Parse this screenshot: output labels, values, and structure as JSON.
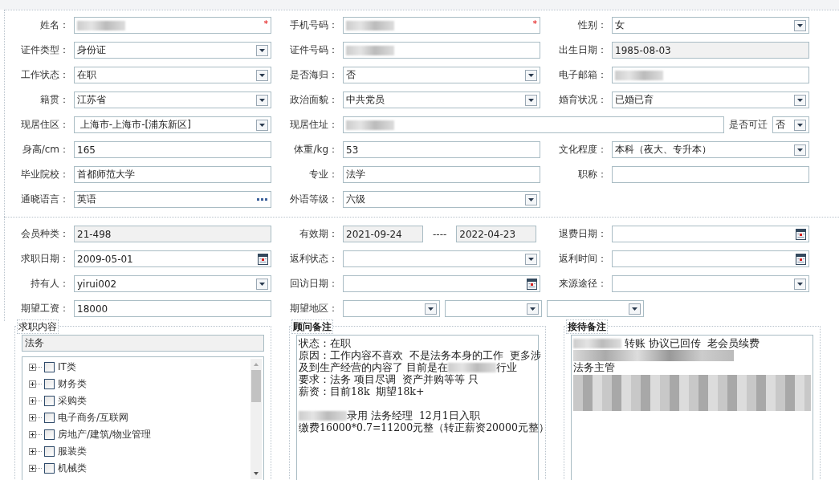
{
  "personal_info": {
    "rows": [
      [
        {
          "label": "姓名：",
          "kind": "text",
          "redacted": true,
          "required_mark": "*"
        },
        {
          "label": "手机号码：",
          "kind": "text",
          "redacted": true,
          "required_mark": "*"
        },
        {
          "label": "性别：",
          "kind": "select",
          "value": "女"
        }
      ],
      [
        {
          "label": "证件类型：",
          "kind": "select",
          "value": "身份证"
        },
        {
          "label": "证件号码：",
          "kind": "text",
          "redacted": true
        },
        {
          "label": "出生日期：",
          "kind": "readonly",
          "value": "1985-08-03"
        }
      ],
      [
        {
          "label": "工作状态：",
          "kind": "select",
          "value": "在职"
        },
        {
          "label": "是否海归：",
          "kind": "select",
          "value": "否"
        },
        {
          "label": "电子邮箱：",
          "kind": "text",
          "redacted": true
        }
      ],
      [
        {
          "label": "籍贯：",
          "kind": "select",
          "value": "江苏省"
        },
        {
          "label": "政治面貌：",
          "kind": "select",
          "value": "中共党员"
        },
        {
          "label": "婚育状况：",
          "kind": "select",
          "value": "已婚已育"
        }
      ],
      [
        {
          "label": "现居住区：",
          "kind": "select",
          "value": " 上海市-上海市-[浦东新区]"
        },
        {
          "label": "现居住址：",
          "kind": "text",
          "redacted": true,
          "wide": true,
          "extra": {
            "label": "是否可迁",
            "kind": "select",
            "value": "否"
          }
        }
      ],
      [
        {
          "label": "身高/cm：",
          "kind": "text",
          "value": "165"
        },
        {
          "label": "体重/kg：",
          "kind": "text",
          "value": "53"
        },
        {
          "label": "文化程度：",
          "kind": "select",
          "value": "本科（夜大、专升本）"
        }
      ],
      [
        {
          "label": "毕业院校：",
          "kind": "text",
          "value": "首都师范大学"
        },
        {
          "label": "专业：",
          "kind": "text",
          "value": "法学"
        },
        {
          "label": "职称：",
          "kind": "text"
        }
      ],
      [
        {
          "label": "通晓语言：",
          "kind": "lookup",
          "value": "英语"
        },
        {
          "label": "外语等级：",
          "kind": "select",
          "value": "六级"
        }
      ]
    ]
  },
  "membership": {
    "rows": [
      [
        {
          "label": "会员种类：",
          "kind": "readonly",
          "value": "21-498"
        },
        {
          "label": "有效期：",
          "kind": "multi",
          "parts": [
            {
              "kind": "readonly",
              "value": "2021-09-24"
            },
            {
              "kind": "separator",
              "text": "----"
            },
            {
              "kind": "readonly",
              "value": "2022-04-23"
            }
          ]
        },
        {
          "label": "退费日期：",
          "kind": "date"
        }
      ],
      [
        {
          "label": "求职日期：",
          "kind": "date",
          "value": "2009-05-01"
        },
        {
          "label": "返利状态：",
          "kind": "select"
        },
        {
          "label": "返利时间：",
          "kind": "date"
        }
      ],
      [
        {
          "label": "持有人：",
          "kind": "select",
          "value": "yirui002"
        },
        {
          "label": "回访日期：",
          "kind": "date"
        },
        {
          "label": "来源途径：",
          "kind": "select"
        }
      ],
      [
        {
          "label": "期望工资：",
          "kind": "text",
          "value": "18000"
        },
        {
          "label": "期望地区：",
          "kind": "multi",
          "parts": [
            {
              "kind": "select"
            },
            {
              "kind": "select"
            },
            {
              "kind": "select"
            }
          ]
        }
      ]
    ]
  },
  "job_content": {
    "title": "求职内容",
    "value": "法务",
    "tree": [
      {
        "label": "IT类",
        "checked": false,
        "expanded": false
      },
      {
        "label": "财务类",
        "checked": false,
        "expanded": false
      },
      {
        "label": "采购类",
        "checked": false,
        "expanded": false
      },
      {
        "label": "电子商务/互联网",
        "checked": false,
        "expanded": false
      },
      {
        "label": "房地产/建筑/物业管理",
        "checked": false,
        "expanded": false
      },
      {
        "label": "服装类",
        "checked": false,
        "expanded": false
      },
      {
        "label": "机械类",
        "checked": false,
        "expanded": false
      }
    ]
  },
  "consultant_notes": {
    "title": "顾问备注",
    "lines": [
      [
        {
          "kind": "text",
          "text": "状态：在职"
        }
      ],
      [
        {
          "kind": "text",
          "text": "原因：工作内容不喜欢  不是法务本身的工作  更多涉"
        }
      ],
      [
        {
          "kind": "text",
          "text": "及到生产经营的内容了 目前是在"
        },
        {
          "kind": "redacted"
        },
        {
          "kind": "text",
          "text": "行业"
        }
      ],
      [
        {
          "kind": "text",
          "text": "要求：法务 项目尽调  资产并购等等 只"
        }
      ],
      [
        {
          "kind": "text",
          "text": "薪资：目前18k  期望18k+"
        }
      ],
      [
        {
          "kind": "blank"
        }
      ],
      [
        {
          "kind": "redacted"
        },
        {
          "kind": "text",
          "text": "录用 法务经理  12月1日入职"
        }
      ],
      [
        {
          "kind": "text",
          "text": "缴费16000*0.7=11200元整（转正薪资20000元整）"
        }
      ]
    ]
  },
  "reception_notes": {
    "title": "接待备注",
    "lines": [
      [
        {
          "kind": "redacted"
        },
        {
          "kind": "text",
          "text": " 转账 协议已回传  老会员续费"
        }
      ],
      [
        {
          "kind": "redacted_line"
        }
      ],
      [
        {
          "kind": "text",
          "text": "法务主管"
        }
      ],
      [
        {
          "kind": "redacted_block"
        }
      ]
    ]
  }
}
